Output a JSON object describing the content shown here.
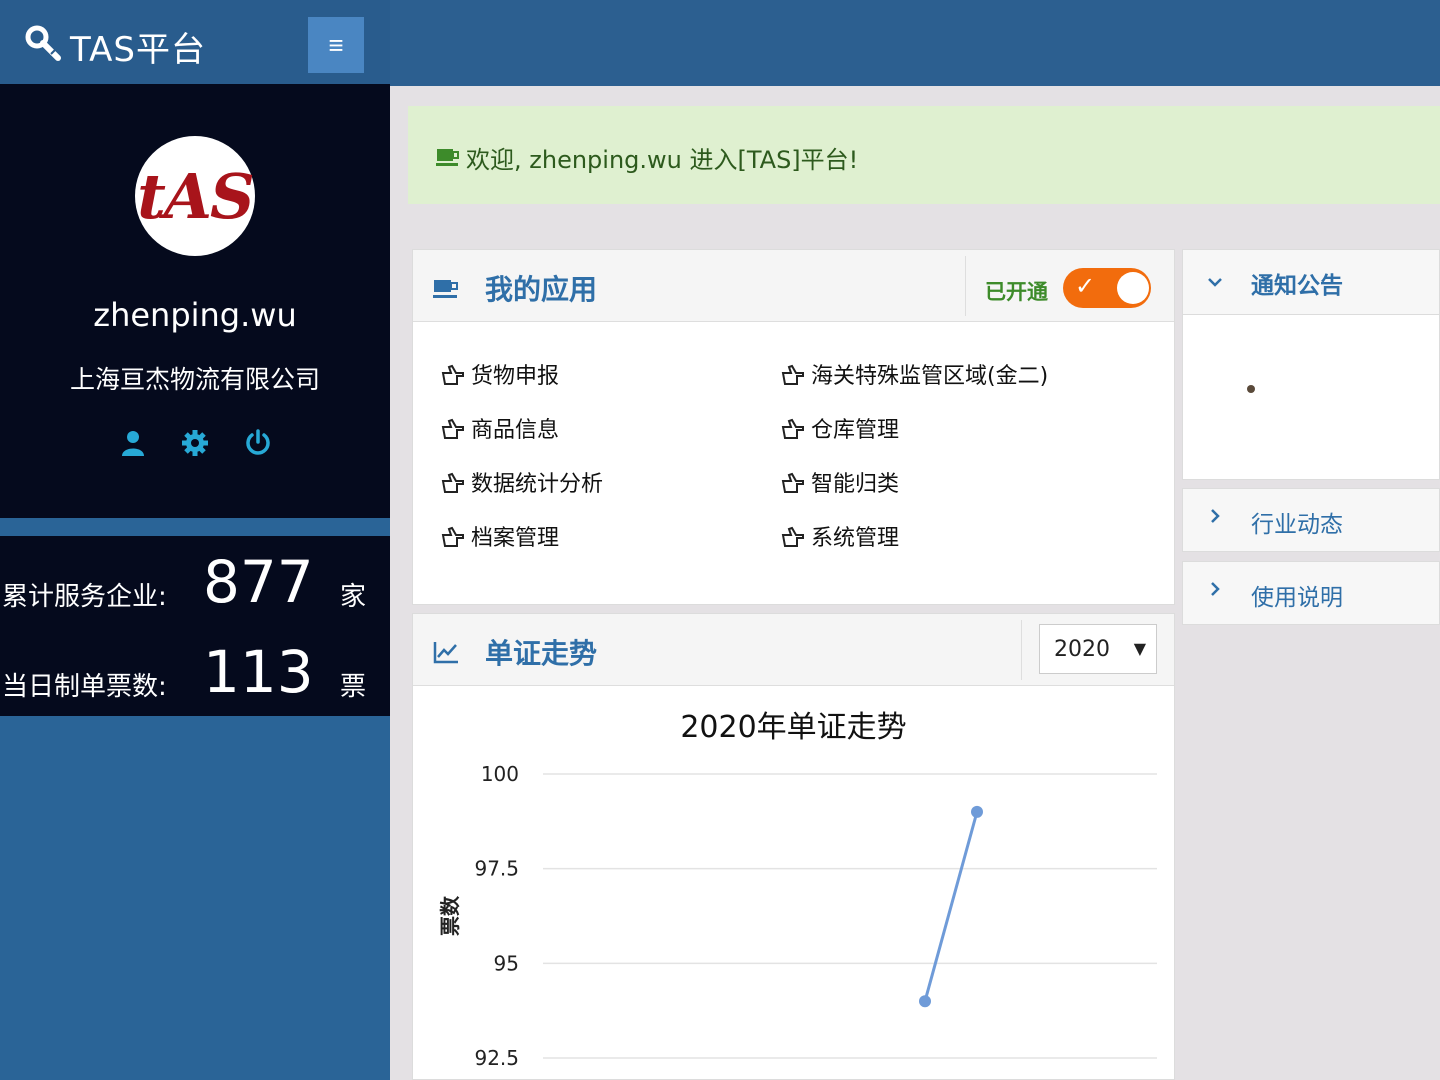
{
  "header": {
    "brand_title": "TAS平台",
    "brand_icon": "wrench-icon",
    "menu_glyph": "≡"
  },
  "profile": {
    "avatar_text": "tAS",
    "username": "zhenping.wu",
    "company": "上海亘杰物流有限公司",
    "icons": [
      "user-icon",
      "gear-icon",
      "power-icon"
    ]
  },
  "stats": [
    {
      "label": "累计服务企业:",
      "value": "877",
      "unit": "家"
    },
    {
      "label": "当日制单票数:",
      "value": "113",
      "unit": "票"
    }
  ],
  "welcome": {
    "text": "欢迎, zhenping.wu 进入[TAS]平台!",
    "icon": "coffee-icon"
  },
  "apps_panel": {
    "title": "我的应用",
    "toggle_label": "已开通",
    "toggle_on": true,
    "items": [
      {
        "label": "货物申报"
      },
      {
        "label": "海关特殊监管区域(金二)"
      },
      {
        "label": "商品信息"
      },
      {
        "label": "仓库管理"
      },
      {
        "label": "数据统计分析"
      },
      {
        "label": "智能归类"
      },
      {
        "label": "档案管理"
      },
      {
        "label": "系统管理"
      }
    ]
  },
  "trend_panel": {
    "title": "单证走势",
    "year_select": "2020",
    "year_options": [
      "2020"
    ]
  },
  "chart_data": {
    "type": "line",
    "title": "2020年单证走势",
    "ylabel": "票数",
    "xlabel": "",
    "ylim": [
      92.5,
      100
    ],
    "yticks": [
      "100",
      "97.5",
      "95",
      "92.5"
    ],
    "series": [
      {
        "values": [
          94.0,
          99.0
        ],
        "x": [
          0,
          1
        ]
      }
    ],
    "grid": true,
    "color": "#6f9bd8"
  },
  "notices": [
    {
      "title": "通知公告",
      "expanded": true
    },
    {
      "title": "行业动态",
      "expanded": false
    },
    {
      "title": "使用说明",
      "expanded": false
    }
  ],
  "colors": {
    "topbar": "#2c5f90",
    "sidebar_dark": "#050a1d",
    "accent_blue": "#2f6fa8",
    "toggle_orange": "#f26c0d",
    "welcome_bg": "#dff0d0"
  }
}
